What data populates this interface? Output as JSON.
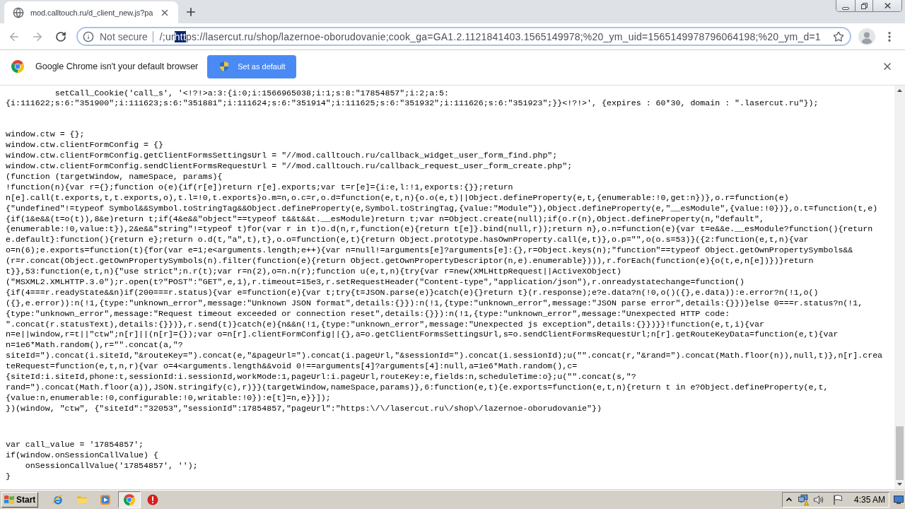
{
  "browser": {
    "tabs": [
      {
        "title": "mod.calltouch.ru/d_client_new.js?pa",
        "selected": true
      }
    ],
    "address_bar": {
      "security_label": "Not secure",
      "url": [
        {
          "text": "/;ur",
          "selected": false
        },
        {
          "text": "htt",
          "selected": true
        },
        {
          "text": "ps://lasercut.ru/shop/lazernoe-oborudovanie;cook_ga=GA1.2.1121841403.1565149978;%20_ym_uid=1565149978796064198;%20_ym_d=1",
          "selected": false
        }
      ]
    },
    "infobar": {
      "message": "Google Chrome isn't your default browser",
      "button": "Set as default"
    }
  },
  "page": {
    "code_blocks": [
      {
        "lines": [
          "          setCall_Cookie('call_s', '<!?!>a:3:{i:0;i:1566965038;i:1;s:8:\"17854857\";i:2;a:5:",
          "{i:111622;s:6:\"351900\";i:111623;s:6:\"351881\";i:111624;s:6:\"351914\";i:111625;s:6:\"351932\";i:111626;s:6:\"351923\";}}<!?!>', {expires : 60*30, domain : \".lasercut.ru\"});"
        ]
      },
      {
        "lines": [
          "window.ctw = {};",
          "window.ctw.clientFormConfig = {}",
          "window.ctw.clientFormConfig.getClientFormsSettingsUrl = \"//mod.calltouch.ru/callback_widget_user_form_find.php\";",
          "window.ctw.clientFormConfig.sendClientFormsRequestUrl = \"//mod.calltouch.ru/callback_request_user_form_create.php\";",
          "(function (targetWindow, nameSpace, params){",
          "!function(n){var r={};function o(e){if(r[e])return r[e].exports;var t=r[e]={i:e,l:!1,exports:{}};return",
          "n[e].call(t.exports,t,t.exports,o),t.l=!0,t.exports}o.m=n,o.c=r,o.d=function(e,t,n){o.o(e,t)||Object.defineProperty(e,t,{enumerable:!0,get:n})},o.r=function(e)",
          "{\"undefined\"!=typeof Symbol&&Symbol.toStringTag&&Object.defineProperty(e,Symbol.toStringTag,{value:\"Module\"}),Object.defineProperty(e,\"__esModule\",{value:!0})},o.t=function(t,e)",
          "{if(1&e&&(t=o(t)),8&e)return t;if(4&e&&\"object\"==typeof t&&t&&t.__esModule)return t;var n=Object.create(null);if(o.r(n),Object.defineProperty(n,\"default\",",
          "{enumerable:!0,value:t}),2&e&&\"string\"!=typeof t)for(var r in t)o.d(n,r,function(e){return t[e]}.bind(null,r));return n},o.n=function(e){var t=e&&e.__esModule?function(){return",
          "e.default}:function(){return e};return o.d(t,\"a\",t),t},o.o=function(e,t){return Object.prototype.hasOwnProperty.call(e,t)},o.p=\"\",o(o.s=53)}({2:function(e,t,n){var",
          "o=n(6);e.exports=function(t){for(var e=1;e<arguments.length;e++){var n=null!=arguments[e]?arguments[e]:{},r=Object.keys(n);\"function\"==typeof Object.getOwnPropertySymbols&&",
          "(r=r.concat(Object.getOwnPropertySymbols(n).filter(function(e){return Object.getOwnPropertyDescriptor(n,e).enumerable}))),r.forEach(function(e){o(t,e,n[e])})}return",
          "t}},53:function(e,t,n){\"use strict\";n.r(t);var r=n(2),o=n.n(r);function u(e,t,n){try{var r=new(XMLHttpRequest||ActiveXObject)",
          "(\"MSXML2.XMLHTTP.3.0\");r.open(t?\"POST\":\"GET\",e,1),r.timeout=15e3,r.setRequestHeader(\"Content-type\",\"application/json\"),r.onreadystatechange=function()",
          "{if(4===r.readyState&&n)if(200===r.status){var e=function(e){var t;try{t=JSON.parse(e)}catch(e){}return t}(r.response);e?e.data?n(!0,o()({},e.data)):e.error?n(!1,o()",
          "({},e.error)):n(!1,{type:\"unknown_error\",message:\"Unknown JSON format\",details:{}}):n(!1,{type:\"unknown_error\",message:\"JSON parse error\",details:{}})}else 0===r.status?n(!1,",
          "{type:\"unknown_error\",message:\"Request timeout exceeded or connection reset\",details:{}}):n(!1,{type:\"unknown_error\",message:\"Unexpected HTTP code:",
          "\".concat(r.statusText),details:{}})},r.send(t)}catch(e){n&&n(!1,{type:\"unknown_error\",message:\"Unexpected js exception\",details:{}})}}!function(e,t,i){var",
          "n=e||window,r=t||\"ctw\";n[r]||(n[r]={});var o=n[r].clientFormConfig||{},a=o.getClientFormsSettingsUrl,s=o.sendClientFormsRequestUrl;n[r].getRouteKeyData=function(e,t){var",
          "n=1e6*Math.random(),r=\"\".concat(a,\"?",
          "siteId=\").concat(i.siteId,\"&routeKey=\").concat(e,\"&pageUrl=\").concat(i.pageUrl,\"&sessionId=\").concat(i.sessionId);u(\"\".concat(r,\"&rand=\").concat(Math.floor(n)),null,t)},n[r].crea",
          "teRequest=function(e,t,n,r){var o=4<arguments.length&&void 0!==arguments[4]?arguments[4]:null,a=1e6*Math.random(),c=",
          "{siteId:i.siteId,phone:t,sessionId:i.sessionId,workMode:1,pageUrl:i.pageUrl,routeKey:e,fields:n,scheduleTime:o};u(\"\".concat(s,\"?",
          "rand=\").concat(Math.floor(a)),JSON.stringify(c),r)}}(targetWindow,nameSpace,params)},6:function(e,t){e.exports=function(e,t,n){return t in e?Object.defineProperty(e,t,",
          "{value:n,enumerable:!0,configurable:!0,writable:!0}):e[t]=n,e}}]);",
          "})(window, \"ctw\", {\"siteId\":\"32053\",\"sessionId\":17854857,\"pageUrl\":\"https:\\/\\/lasercut.ru\\/shop\\/lazernoe-oborudovanie\"})"
        ]
      },
      {
        "lines": [
          "var call_value = '17854857';",
          "if(window.onSessionCallValue) {",
          "    onSessionCallValue('17854857', '');",
          "}"
        ]
      }
    ]
  },
  "taskbar": {
    "start": "Start",
    "apps": [
      {
        "kind": "orbit",
        "selected": false
      },
      {
        "kind": "folder",
        "selected": false
      },
      {
        "kind": "media",
        "selected": false
      },
      {
        "kind": "browser",
        "selected": true
      },
      {
        "kind": "alert",
        "selected": false
      }
    ],
    "clock": "4:35 AM"
  }
}
